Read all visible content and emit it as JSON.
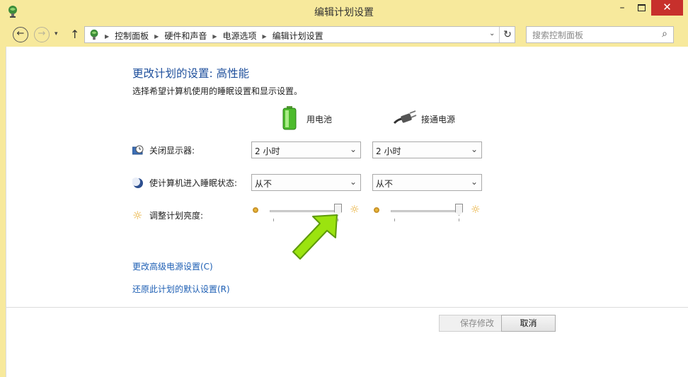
{
  "window": {
    "title": "编辑计划设置",
    "minimize": "–",
    "close": "✕"
  },
  "nav": {
    "back": "←",
    "forward": "→",
    "dropdown": "▾",
    "up": "↑",
    "breadcrumb": [
      "控制面板",
      "硬件和声音",
      "电源选项",
      "编辑计划设置"
    ],
    "refresh": "↻",
    "search_placeholder": "搜索控制面板"
  },
  "main": {
    "heading": "更改计划的设置: 高性能",
    "subtext": "选择希望计算机使用的睡眠设置和显示设置。",
    "columns": {
      "battery": "用电池",
      "plugged": "接通电源"
    },
    "rows": {
      "display_label": "关闭显示器:",
      "display_battery": "2 小时",
      "display_plugged": "2 小时",
      "sleep_label": "使计算机进入睡眠状态:",
      "sleep_battery": "从不",
      "sleep_plugged": "从不",
      "brightness_label": "调整计划亮度:"
    },
    "brightness": {
      "battery_percent": 100,
      "plugged_percent": 100
    },
    "links": {
      "advanced": "更改高级电源设置(C)",
      "restore": "还原此计划的默认设置(R)"
    },
    "buttons": {
      "save": "保存修改",
      "cancel": "取消"
    }
  },
  "colors": {
    "title_bar": "#f7e99c",
    "heading": "#1e4f9c",
    "link": "#1e5fb4",
    "close_button": "#c7302c",
    "annotation_arrow": "#9be30f"
  },
  "icons": [
    "power-options-icon",
    "battery-icon",
    "power-plug-icon",
    "monitor-clock-icon",
    "moon-sleep-icon",
    "sun-icon",
    "search-icon"
  ]
}
